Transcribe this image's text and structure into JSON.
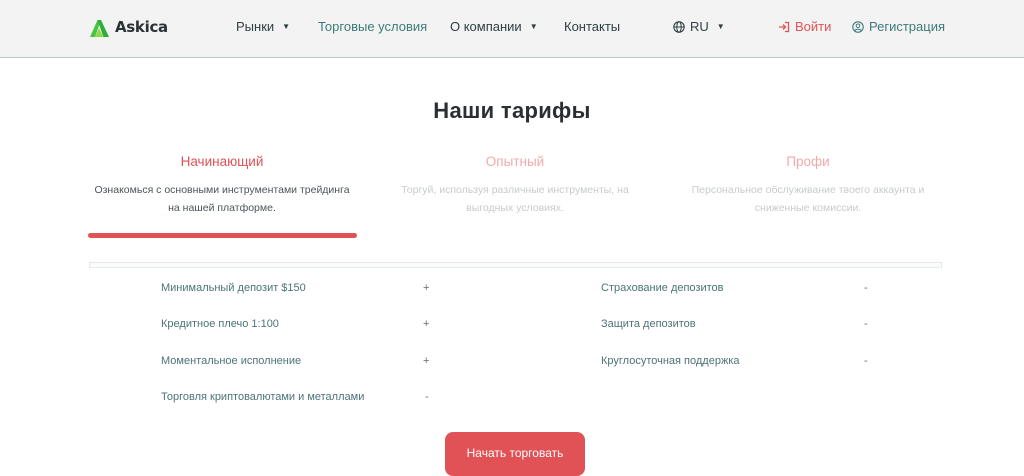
{
  "header": {
    "logo_text": "Askica",
    "nav": {
      "markets": "Рынки",
      "conditions": "Торговые условия",
      "about": "О компании",
      "contacts": "Контакты",
      "language": "RU"
    },
    "login": "Войти",
    "register": "Регистрация"
  },
  "colors": {
    "accent": "#e05256",
    "brand_green": "#2db84c",
    "teal": "#3d7b79"
  },
  "main": {
    "title": "Наши тарифы",
    "tabs": [
      {
        "label": "Начинающий",
        "desc_line1": "Ознакомься с основными инструментами трейдинга",
        "desc_line2": "на нашей платформе.",
        "active": true
      },
      {
        "label": "Опытный",
        "desc_line1": "Торгуй, используя различные инструменты, на",
        "desc_line2": "выгодных условиях.",
        "active": false
      },
      {
        "label": "Профи",
        "desc_line1": "Персональное обслуживание твоего аккаунта и",
        "desc_line2": "сниженные комиссии.",
        "active": false
      }
    ],
    "features_left": [
      {
        "label": "Минимальный депозит $150",
        "mark": "+"
      },
      {
        "label": "Кредитное плечо 1:100",
        "mark": "+"
      },
      {
        "label": "Моментальное исполнение",
        "mark": "+"
      },
      {
        "label": "Торговля криптовалютами и металлами",
        "mark": "-"
      }
    ],
    "features_right": [
      {
        "label": "Страхование депозитов",
        "mark": "-"
      },
      {
        "label": "Защита депозитов",
        "mark": "-"
      },
      {
        "label": "Круглосуточная поддержка",
        "mark": "-"
      }
    ],
    "cta": "Начать торговать"
  }
}
